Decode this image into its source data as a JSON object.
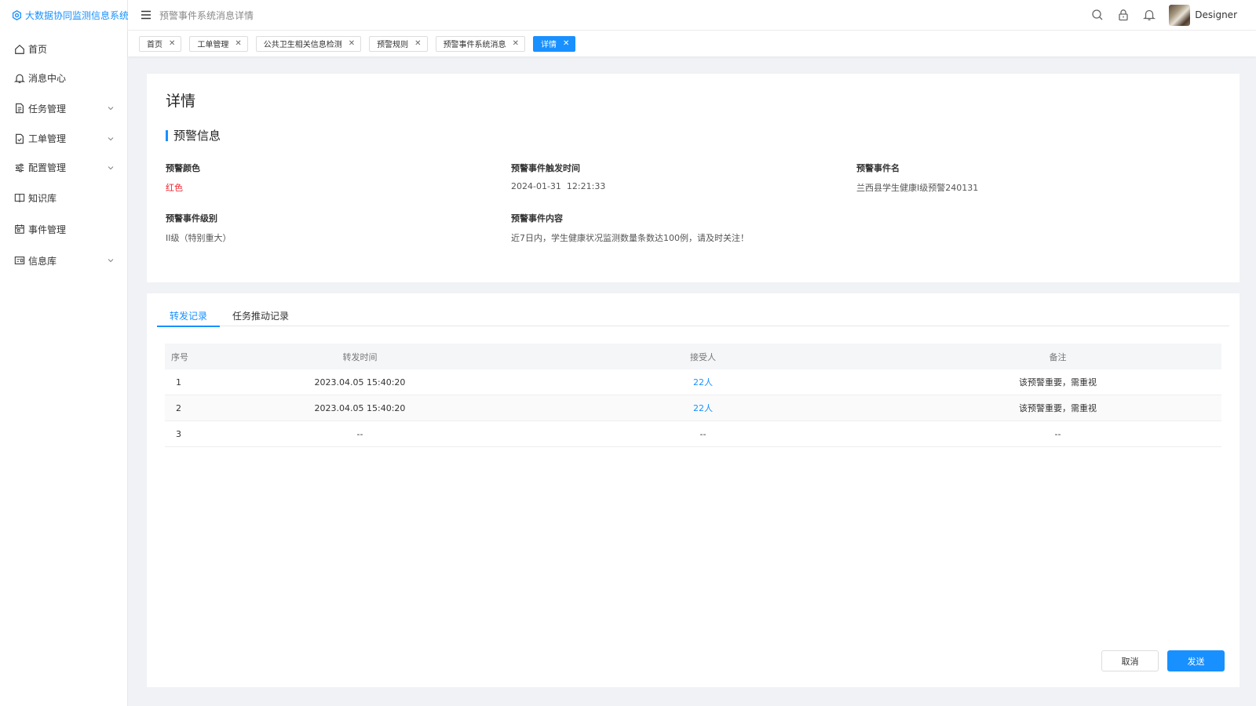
{
  "app": {
    "title": "大数据协同监测信息系统",
    "brand_color": "#1890ff"
  },
  "sidebar": {
    "items": [
      {
        "label": "首页",
        "icon": "home-icon",
        "expandable": false
      },
      {
        "label": "消息中心",
        "icon": "bell-icon",
        "expandable": false
      },
      {
        "label": "任务管理",
        "icon": "document-icon",
        "expandable": true
      },
      {
        "label": "工单管理",
        "icon": "file-check-icon",
        "expandable": true
      },
      {
        "label": "配置管理",
        "icon": "sliders-icon",
        "expandable": true
      },
      {
        "label": "知识库",
        "icon": "book-icon",
        "expandable": false
      },
      {
        "label": "事件管理",
        "icon": "calendar-icon",
        "expandable": false
      },
      {
        "label": "信息库",
        "icon": "id-card-icon",
        "expandable": true
      }
    ]
  },
  "header": {
    "title": "预警事件系统消息详情",
    "username": "Designer",
    "icons": [
      "search-icon",
      "lock-icon",
      "bell-icon"
    ]
  },
  "tabs": [
    {
      "label": "首页",
      "active": false
    },
    {
      "label": "工单管理",
      "active": false
    },
    {
      "label": "公共卫生相关信息检测",
      "active": false
    },
    {
      "label": "预警规则",
      "active": false
    },
    {
      "label": "预警事件系统消息",
      "active": false
    },
    {
      "label": "详情",
      "active": true
    }
  ],
  "detail": {
    "page_title": "详情",
    "section_title": "预警信息",
    "fields": {
      "color": {
        "label": "预警颜色",
        "value": "红色",
        "value_color": "#f5222d"
      },
      "trigger_time": {
        "label": "预警事件触发时间",
        "value": "2024-01-31  12:21:33"
      },
      "event_name": {
        "label": "预警事件名",
        "value": "兰西县学生健康I级预警240131"
      },
      "level": {
        "label": "预警事件级别",
        "value": "II级（特别重大）"
      },
      "content": {
        "label": "预警事件内容",
        "value": "近7日内，学生健康状况监测数量条数达100例，请及时关注！"
      }
    }
  },
  "records": {
    "tabs": [
      "转发记录",
      "任务推动记录"
    ],
    "active_tab": 0,
    "columns": [
      "序号",
      "转发时间",
      "接受人",
      "备注"
    ],
    "rows": [
      {
        "index": "1",
        "time": "2023.04.05 15:40:20",
        "receiver": "22人",
        "note": "该预警重要，需重视"
      },
      {
        "index": "2",
        "time": "2023.04.05 15:40:20",
        "receiver": "22人",
        "note": "该预警重要，需重视"
      },
      {
        "index": "3",
        "time": "--",
        "receiver": "--",
        "note": "--"
      }
    ]
  },
  "actions": {
    "cancel": "取消",
    "send": "发送"
  }
}
